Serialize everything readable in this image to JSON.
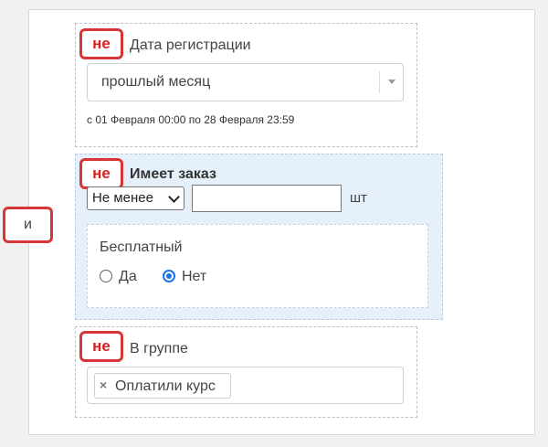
{
  "logic": {
    "and_label": "и",
    "not_label": "не"
  },
  "registration": {
    "title": "Дата регистрации",
    "period_value": "прошлый месяц",
    "date_range": "с 01 Февраля 00:00 по 28 Февраля 23:59"
  },
  "order": {
    "title": "Имеет заказ",
    "comparator": "Не менее",
    "quantity_value": "",
    "unit": "шт",
    "free": {
      "label": "Бесплатный",
      "options": [
        "Да",
        "Нет"
      ],
      "selected": "Нет"
    }
  },
  "group": {
    "title": "В группе",
    "tags": [
      "Оплатили курс"
    ]
  },
  "colors": {
    "badge_border": "#d63636",
    "badge_text": "#d92020",
    "highlight_bg": "#e5f0fb",
    "radio_accent": "#1a73e8"
  }
}
